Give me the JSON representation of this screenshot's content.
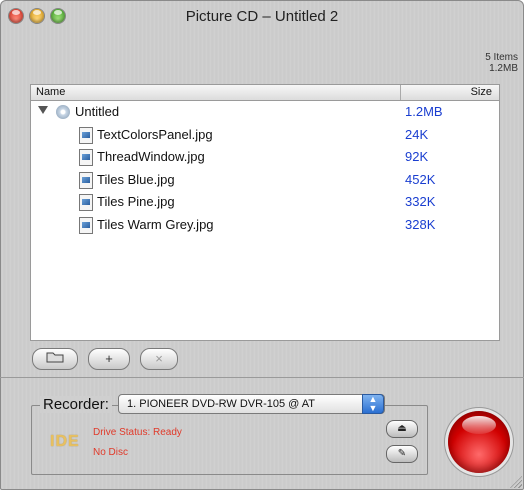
{
  "window": {
    "title": "Picture CD – Untitled 2"
  },
  "summary": {
    "items": "5 Items",
    "size": "1.2MB"
  },
  "list": {
    "headers": {
      "name": "Name",
      "size": "Size"
    },
    "root": {
      "name": "Untitled",
      "size": "1.2MB",
      "icon": "disc-icon"
    },
    "files": [
      {
        "name": "TextColorsPanel.jpg",
        "size": "24K"
      },
      {
        "name": "ThreadWindow.jpg",
        "size": "92K"
      },
      {
        "name": "Tiles Blue.jpg",
        "size": "452K"
      },
      {
        "name": "Tiles Pine.jpg",
        "size": "332K"
      },
      {
        "name": "Tiles Warm Grey.jpg",
        "size": "328K"
      }
    ]
  },
  "toolbar": {
    "open_icon": "folder-icon",
    "add": "+",
    "remove": "×"
  },
  "recorder": {
    "label": "Recorder:",
    "selected": "1. PIONEER DVD-RW  DVR-105 @ AT",
    "interface": "IDE",
    "drive_status": "Drive Status: Ready",
    "disc_status": "No Disc",
    "eject_icon": "eject-icon",
    "erase_icon": "erase-icon"
  },
  "colors": {
    "size_text": "#1a3ed0",
    "status_text": "#e03a2a",
    "record": "#d00000"
  }
}
